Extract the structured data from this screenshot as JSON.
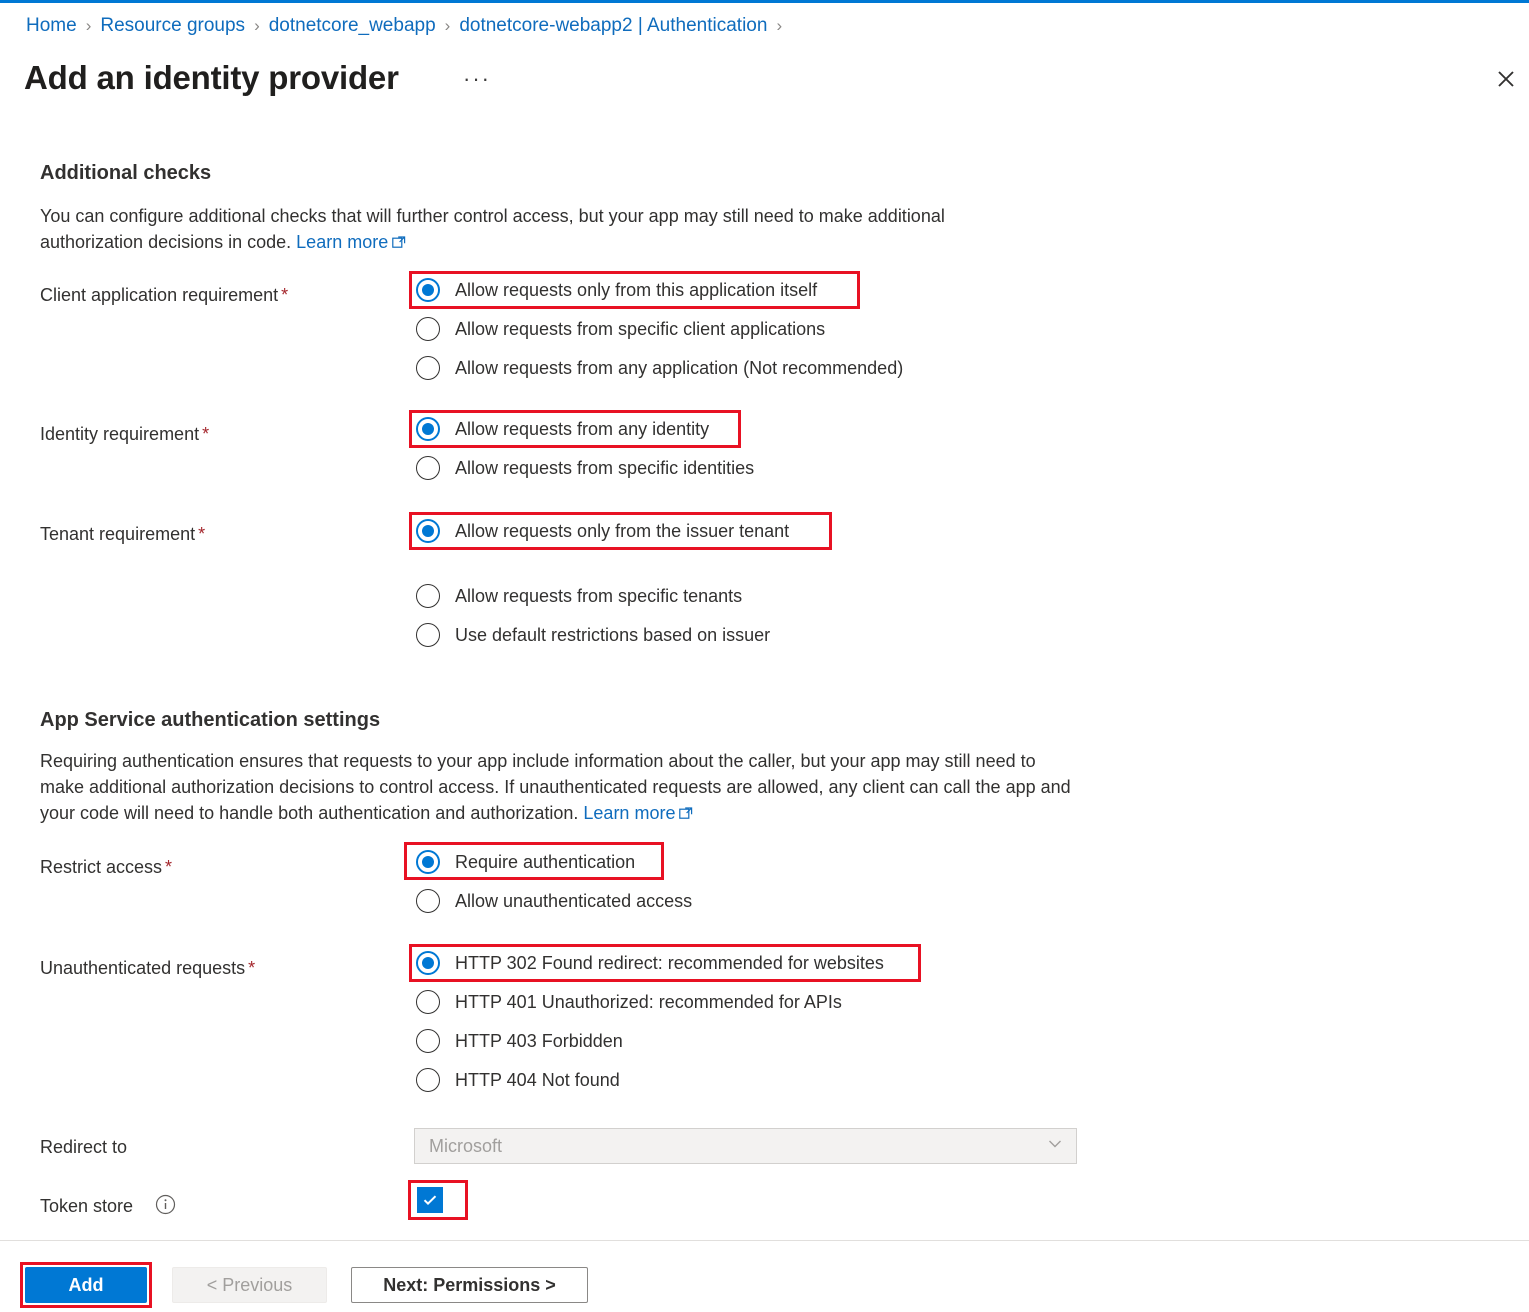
{
  "theme": {
    "accent": "#0078d4",
    "link": "#0f6cbd",
    "highlight": "#e81123",
    "required_star": "#a4262c",
    "text": "#323130"
  },
  "header": {
    "breadcrumb": [
      "Home",
      "Resource groups",
      "dotnetcore_webapp",
      "dotnetcore-webapp2 | Authentication"
    ],
    "breadcrumb_separator": "›",
    "title": "Add an identity provider",
    "more_menu": "···",
    "close_label": "Close"
  },
  "sections": [
    {
      "heading": "Additional checks",
      "description_part1": "You can configure additional checks that will further control access, but your app may still need to make additional authorization decisions in code.",
      "learn_more": "Learn more"
    },
    {
      "heading": "App Service authentication settings",
      "description_part1": "Requiring authentication ensures that requests to your app include information about the caller, but your app may still need to make additional authorization decisions to control access. If unauthenticated requests are allowed, any client can call the app and your code will need to handle both authentication and authorization.",
      "learn_more": "Learn more"
    }
  ],
  "fields": {
    "client_application_requirement": {
      "label": "Client application requirement",
      "required": "*",
      "options": [
        {
          "label": "Allow requests only from this application itself",
          "checked": true,
          "highlighted": true
        },
        {
          "label": "Allow requests from specific client applications",
          "checked": false,
          "highlighted": false
        },
        {
          "label": "Allow requests from any application (Not recommended)",
          "checked": false,
          "highlighted": false
        }
      ]
    },
    "identity_requirement": {
      "label": "Identity requirement",
      "required": "*",
      "options": [
        {
          "label": "Allow requests from any identity",
          "checked": true,
          "highlighted": true
        },
        {
          "label": "Allow requests from specific identities",
          "checked": false,
          "highlighted": false
        }
      ]
    },
    "tenant_requirement": {
      "label": "Tenant requirement",
      "required": "*",
      "options": [
        {
          "label": "Allow requests only from the issuer tenant",
          "checked": true,
          "highlighted": true
        },
        {
          "label": "Allow requests from specific tenants",
          "checked": false,
          "highlighted": false
        },
        {
          "label": "Use default restrictions based on issuer",
          "checked": false,
          "highlighted": false
        }
      ]
    },
    "restrict_access": {
      "label": "Restrict access",
      "required": "*",
      "options": [
        {
          "label": "Require authentication",
          "checked": true,
          "highlighted": true
        },
        {
          "label": "Allow unauthenticated access",
          "checked": false,
          "highlighted": false
        }
      ]
    },
    "unauthenticated_requests": {
      "label": "Unauthenticated requests",
      "required": "*",
      "options": [
        {
          "label": "HTTP 302 Found redirect: recommended for websites",
          "checked": true,
          "highlighted": true
        },
        {
          "label": "HTTP 401 Unauthorized: recommended for APIs",
          "checked": false,
          "highlighted": false
        },
        {
          "label": "HTTP 403 Forbidden",
          "checked": false,
          "highlighted": false
        },
        {
          "label": "HTTP 404 Not found",
          "checked": false,
          "highlighted": false
        }
      ]
    },
    "redirect_to": {
      "label": "Redirect to",
      "value": "Microsoft",
      "disabled": true
    },
    "token_store": {
      "label": "Token store",
      "checked": true,
      "highlighted": true,
      "info_tooltip": "i"
    }
  },
  "footer": {
    "add_label": "Add",
    "previous_label": "< Previous",
    "next_label": "Next: Permissions >"
  }
}
